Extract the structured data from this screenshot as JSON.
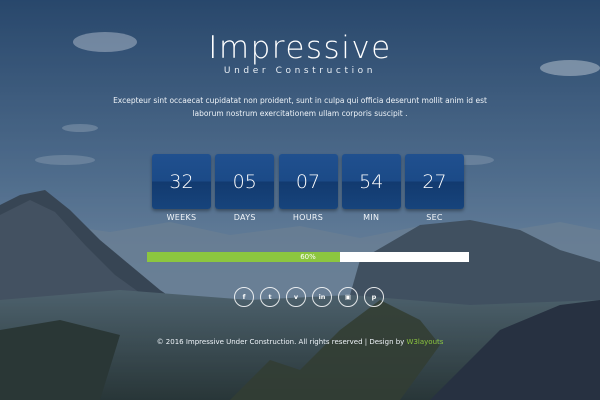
{
  "header": {
    "title": "Impressive",
    "subtitle": "Under Construction",
    "description": "Excepteur sint occaecat cupidatat non proident, sunt in culpa qui officia deserunt mollit anim id est laborum nostrum exercitationem ullam corporis suscipit ."
  },
  "countdown": {
    "units": [
      {
        "value": "32",
        "label": "WEEKS"
      },
      {
        "value": "05",
        "label": "DAYS"
      },
      {
        "value": "07",
        "label": "HOURS"
      },
      {
        "value": "54",
        "label": "MIN"
      },
      {
        "value": "27",
        "label": "SEC"
      }
    ]
  },
  "progress": {
    "percent": 60,
    "label": "60%",
    "fill_color": "#8cc63f",
    "track_color": "#ffffff"
  },
  "social": {
    "icons": [
      {
        "name": "facebook-icon",
        "glyph": "f"
      },
      {
        "name": "twitter-icon",
        "glyph": "t"
      },
      {
        "name": "vimeo-icon",
        "glyph": "v"
      },
      {
        "name": "linkedin-icon",
        "glyph": "in"
      },
      {
        "name": "instagram-icon",
        "glyph": "▣"
      },
      {
        "name": "pinterest-icon",
        "glyph": "p"
      }
    ]
  },
  "footer": {
    "text": "© 2016 Impressive Under Construction. All rights reserved | Design by",
    "brand": "W3layouts",
    "brand_color": "#8cc63f"
  }
}
